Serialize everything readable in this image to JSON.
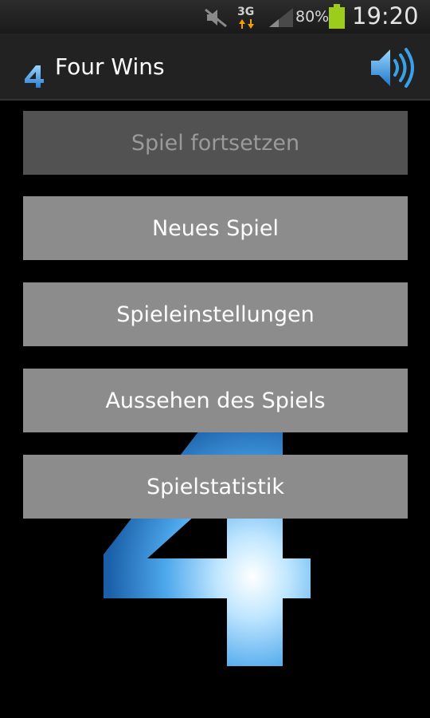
{
  "status_bar": {
    "network": "3G",
    "battery_percent": "80%",
    "time": "19:20",
    "icons": [
      "mute-icon",
      "3g-data-icon",
      "signal-icon",
      "battery-icon"
    ]
  },
  "app_bar": {
    "title": "Four Wins",
    "logo_icon": "four-logo-icon",
    "sound_icon": "speaker-volume-icon"
  },
  "menu": {
    "items": [
      {
        "label": "Spiel fortsetzen",
        "enabled": false
      },
      {
        "label": "Neues Spiel",
        "enabled": true
      },
      {
        "label": "Spieleinstellungen",
        "enabled": true
      },
      {
        "label": "Aussehen des Spiels",
        "enabled": true
      },
      {
        "label": "Spielstatistik",
        "enabled": true
      }
    ]
  },
  "colors": {
    "background": "#000000",
    "button": "#8c8c8c",
    "button_disabled": "#525252",
    "accent_blue": "#3aa0e8",
    "battery_green": "#9ccc1c"
  }
}
